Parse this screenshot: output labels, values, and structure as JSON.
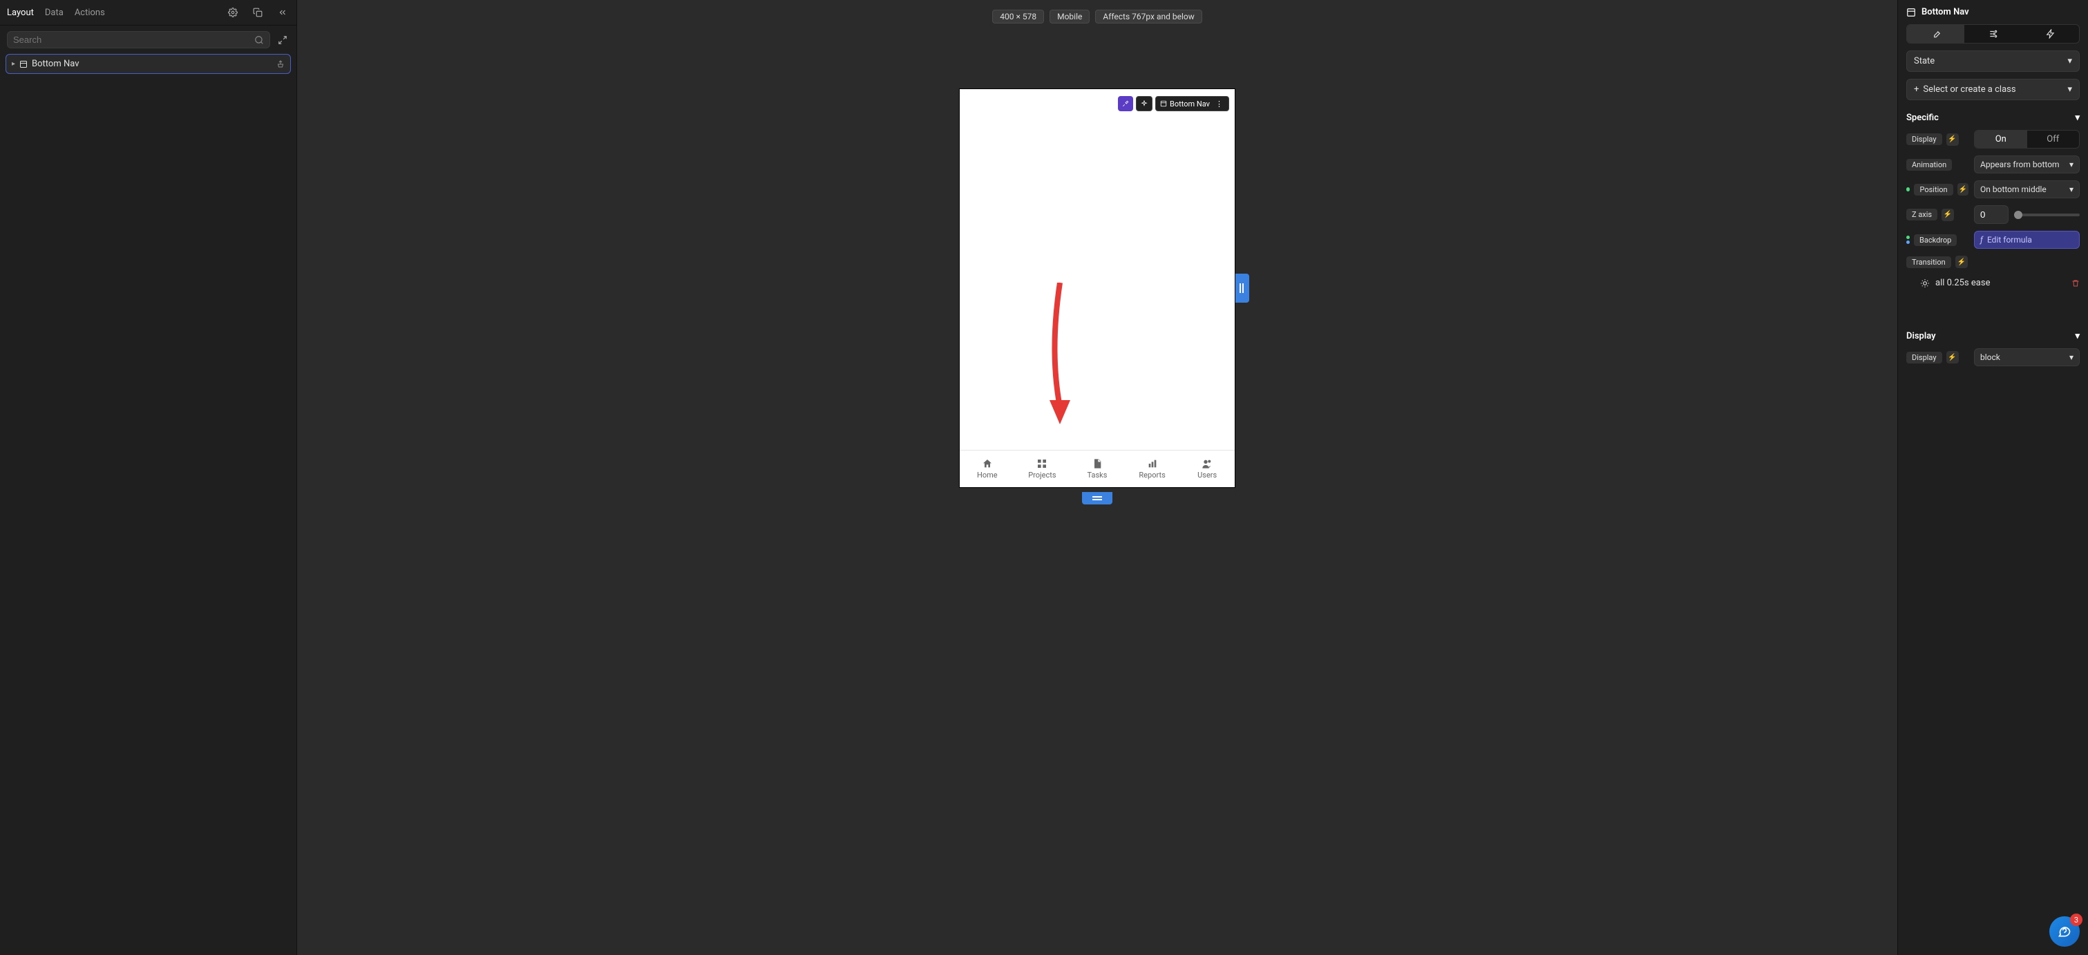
{
  "left": {
    "tabs": [
      "Layout",
      "Data",
      "Actions"
    ],
    "active_tab": 0,
    "search_placeholder": "Search",
    "tree": {
      "items": [
        {
          "label": "Bottom Nav"
        }
      ]
    }
  },
  "canvas": {
    "dimensions": "400 × 578",
    "device": "Mobile",
    "breakpoint": "Affects 767px and below",
    "selected_badge": "Bottom Nav",
    "bottom_nav_items": [
      {
        "icon": "home",
        "label": "Home"
      },
      {
        "icon": "grid",
        "label": "Projects"
      },
      {
        "icon": "file",
        "label": "Tasks"
      },
      {
        "icon": "chart",
        "label": "Reports"
      },
      {
        "icon": "users",
        "label": "Users"
      }
    ]
  },
  "right": {
    "title": "Bottom Nav",
    "state_label": "State",
    "class_selector": "Select or create a class",
    "sections": {
      "specific": {
        "title": "Specific",
        "display_label": "Display",
        "display_on": "On",
        "display_off": "Off",
        "animation_label": "Animation",
        "animation_value": "Appears from bottom",
        "position_label": "Position",
        "position_value": "On bottom middle",
        "zaxis_label": "Z axis",
        "zaxis_value": "0",
        "backdrop_label": "Backdrop",
        "backdrop_value": "Edit formula",
        "transition_label": "Transition",
        "transition_value": "all 0.25s ease"
      },
      "display": {
        "title": "Display",
        "display_label": "Display",
        "display_value": "block"
      }
    }
  },
  "help_badge_count": "3"
}
